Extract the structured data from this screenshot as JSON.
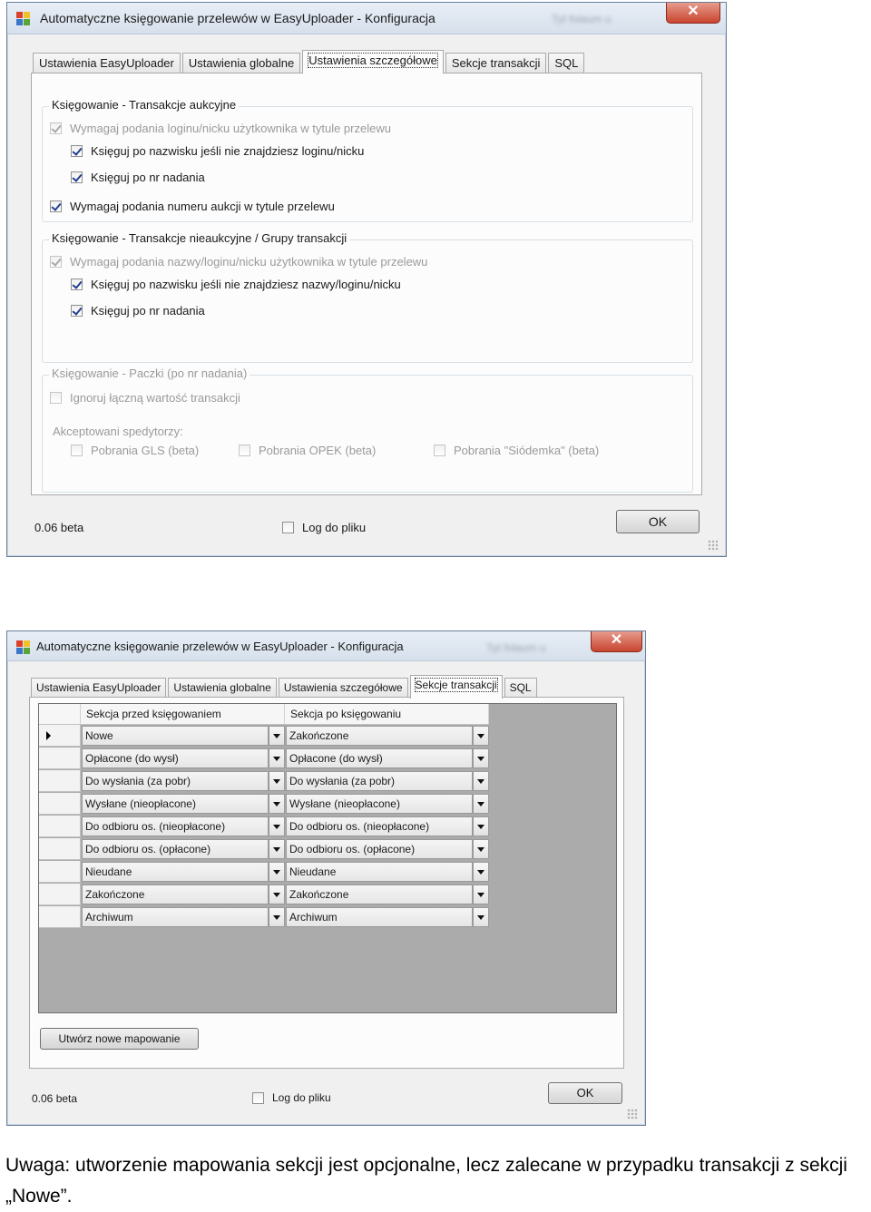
{
  "window1": {
    "title": "Automatyczne księgowanie przelewów w EasyUploader - Konfiguracja",
    "blurred_title_right": "Tyt folaum u",
    "close_label": "✕",
    "tabs": [
      "Ustawienia EasyUploader",
      "Ustawienia globalne",
      "Ustawienia szczegółowe",
      "Sekcje transakcji",
      "SQL"
    ],
    "active_tab": 2,
    "group1": {
      "label": "Księgowanie - Transakcje aukcyjne",
      "items": [
        {
          "label": "Wymagaj podania loginu/nicku użytkownika w tytule przelewu",
          "checked": true,
          "enabled": false
        },
        {
          "label": "Księguj po nazwisku jeśli nie znajdziesz loginu/nicku",
          "checked": true,
          "enabled": true
        },
        {
          "label": "Księguj po nr nadania",
          "checked": true,
          "enabled": true
        },
        {
          "label": "Wymagaj podania numeru aukcji w tytule przelewu",
          "checked": true,
          "enabled": true
        }
      ]
    },
    "group2": {
      "label": "Księgowanie - Transakcje nieaukcyjne / Grupy transakcji",
      "items": [
        {
          "label": "Wymagaj podania nazwy/loginu/nicku użytkownika w tytule przelewu",
          "checked": true,
          "enabled": false
        },
        {
          "label": "Księguj po nazwisku jeśli nie znajdziesz nazwy/loginu/nicku",
          "checked": true,
          "enabled": true
        },
        {
          "label": "Księguj po nr nadania",
          "checked": true,
          "enabled": true
        }
      ]
    },
    "group3": {
      "label": "Księgowanie - Paczki (po nr nadania)",
      "ignore_label": "Ignoruj łączną wartość transakcji",
      "carriers_label": "Akceptowani spedytorzy:",
      "carriers": [
        {
          "label": "Pobrania GLS (beta)",
          "checked": false
        },
        {
          "label": "Pobrania OPEK (beta)",
          "checked": false
        },
        {
          "label": "Pobrania \"Siódemka\" (beta)",
          "checked": false
        }
      ]
    },
    "version": "0.06 beta",
    "log_label": "Log do pliku",
    "ok_label": "OK"
  },
  "window2": {
    "title": "Automatyczne księgowanie przelewów w EasyUploader - Konfiguracja",
    "blurred_title_right": "Tyt folaum u",
    "close_label": "✕",
    "tabs": [
      "Ustawienia EasyUploader",
      "Ustawienia globalne",
      "Ustawienia szczegółowe",
      "Sekcje transakcji",
      "SQL"
    ],
    "active_tab": 3,
    "grid": {
      "col1": "Sekcja przed księgowaniem",
      "col2": "Sekcja po księgowaniu",
      "rows": [
        {
          "before": "Nowe",
          "after": "Zakończone"
        },
        {
          "before": "Opłacone (do wysł)",
          "after": "Opłacone (do wysł)"
        },
        {
          "before": "Do wysłania (za pobr)",
          "after": "Do wysłania (za pobr)"
        },
        {
          "before": "Wysłane (nieopłacone)",
          "after": "Wysłane (nieopłacone)"
        },
        {
          "before": "Do odbioru os. (nieopłacone)",
          "after": "Do odbioru os. (nieopłacone)"
        },
        {
          "before": "Do odbioru os. (opłacone)",
          "after": "Do odbioru os. (opłacone)"
        },
        {
          "before": "Nieudane",
          "after": "Nieudane"
        },
        {
          "before": "Zakończone",
          "after": "Zakończone"
        },
        {
          "before": "Archiwum",
          "after": "Archiwum"
        }
      ]
    },
    "new_mapping_label": "Utwórz nowe mapowanie",
    "version": "0.06 beta",
    "log_label": "Log do pliku",
    "ok_label": "OK"
  },
  "caption": "Uwaga: utworzenie mapowania sekcji jest opcjonalne, lecz zalecane w przypadku transakcji z sekcji „Nowe”."
}
